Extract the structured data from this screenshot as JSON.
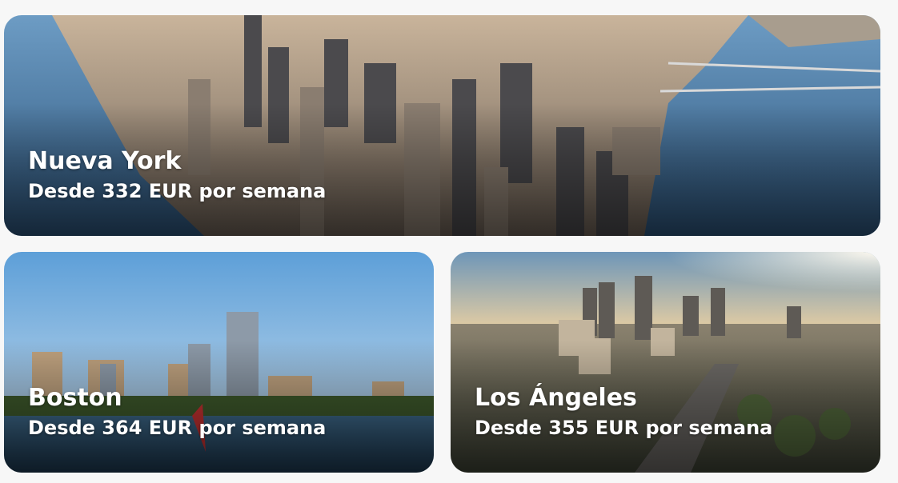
{
  "destinations": [
    {
      "name": "Nueva York",
      "price": "Desde 332 EUR por semana",
      "scene": "new-york-aerial-skyline"
    },
    {
      "name": "Boston",
      "price": "Desde 364 EUR por semana",
      "scene": "boston-skyline-river"
    },
    {
      "name": "Los Ángeles",
      "price": "Desde 355 EUR por semana",
      "scene": "los-angeles-downtown-freeway"
    }
  ]
}
